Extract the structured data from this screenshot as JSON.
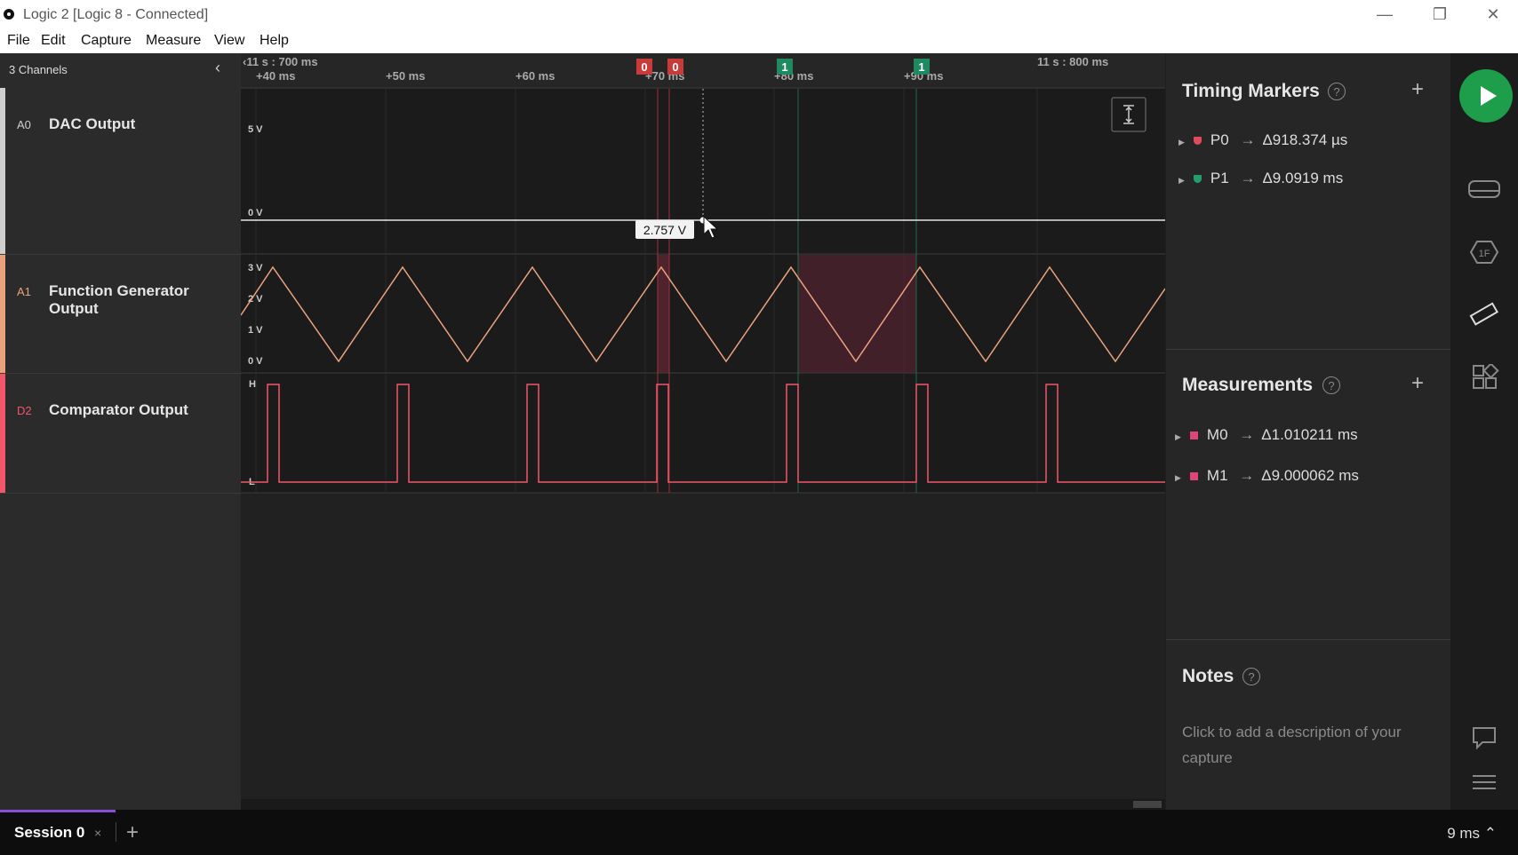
{
  "window": {
    "title": "Logic 2 [Logic 8 - Connected]",
    "minimize": "—",
    "restore": "❐",
    "close": "✕"
  },
  "menu": [
    "File",
    "Edit",
    "Capture",
    "Measure",
    "View",
    "Help"
  ],
  "sidebar": {
    "header": "3 Channels",
    "collapse": "‹",
    "channels": [
      {
        "id": "A0",
        "name": "DAC Output",
        "color": "#cfcfcf"
      },
      {
        "id": "A1",
        "name": "Function Generator Output",
        "color": "#e9a27b"
      },
      {
        "id": "D2",
        "name": "Comparator Output",
        "color": "#f2566a"
      }
    ]
  },
  "timeline": {
    "start_label": "‹11 s : 700 ms",
    "end_label": "11 s : 800 ms",
    "ticks": [
      "+40 ms",
      "+50 ms",
      "+60 ms",
      "+70 ms",
      "+80 ms",
      "+90 ms"
    ],
    "marker_flags": [
      {
        "text": "0",
        "color": "#c93a3a"
      },
      {
        "text": "0",
        "color": "#c93a3a"
      },
      {
        "text": "1",
        "color": "#1f8a60"
      },
      {
        "text": "1",
        "color": "#1f8a60"
      }
    ]
  },
  "analog": {
    "a0_labels": [
      "5 V",
      "0 V"
    ],
    "a0_level_v": 2.757,
    "a1_labels": [
      "3 V",
      "2 V",
      "1 V",
      "0 V"
    ],
    "d2_labels": [
      "H",
      "L"
    ],
    "tooltip": "2.757 V"
  },
  "timing_markers": {
    "title": "Timing Markers",
    "help": "?",
    "add": "+",
    "items": [
      {
        "name": "P0",
        "arrow": "→",
        "value": "Δ918.374 µs",
        "color": "#e04a5a"
      },
      {
        "name": "P1",
        "arrow": "→",
        "value": "Δ9.0919 ms",
        "color": "#22a06b"
      }
    ]
  },
  "measurements": {
    "title": "Measurements",
    "help": "?",
    "add": "+",
    "items": [
      {
        "name": "M0",
        "arrow": "→",
        "value": "Δ1.010211 ms",
        "color": "#e0457a"
      },
      {
        "name": "M1",
        "arrow": "→",
        "value": "Δ9.000062 ms",
        "color": "#e0457a"
      }
    ]
  },
  "notes": {
    "title": "Notes",
    "help": "?",
    "placeholder": "Click to add a description of your capture"
  },
  "bottom": {
    "session_tab": "Session 0",
    "tab_close": "×",
    "new_tab": "+",
    "zoom": "9 ms ⌃"
  }
}
